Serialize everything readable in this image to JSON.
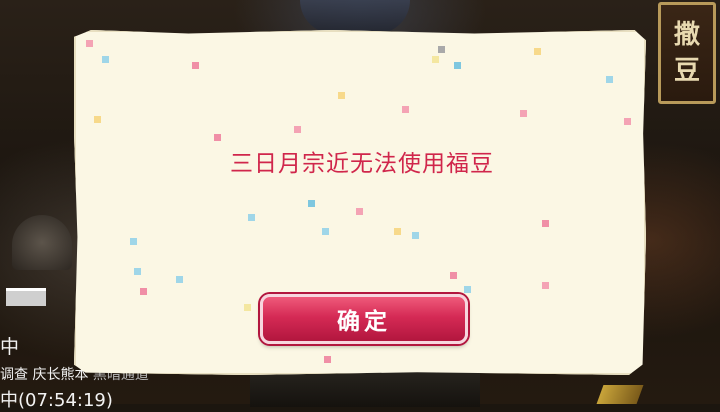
{
  "side_sign": {
    "line1": "撒",
    "line2": "豆"
  },
  "status": {
    "line1": "中",
    "line2_a": "调查 庆长熊本",
    "line2_b": "黑暗通道",
    "line3": "中(07:54:19)"
  },
  "dialog": {
    "message": "三日月宗近无法使用福豆",
    "confirm_label": "确定"
  },
  "colors": {
    "message": "#d0264b",
    "button": "#d52a55",
    "panel": "#fbf7e4"
  }
}
